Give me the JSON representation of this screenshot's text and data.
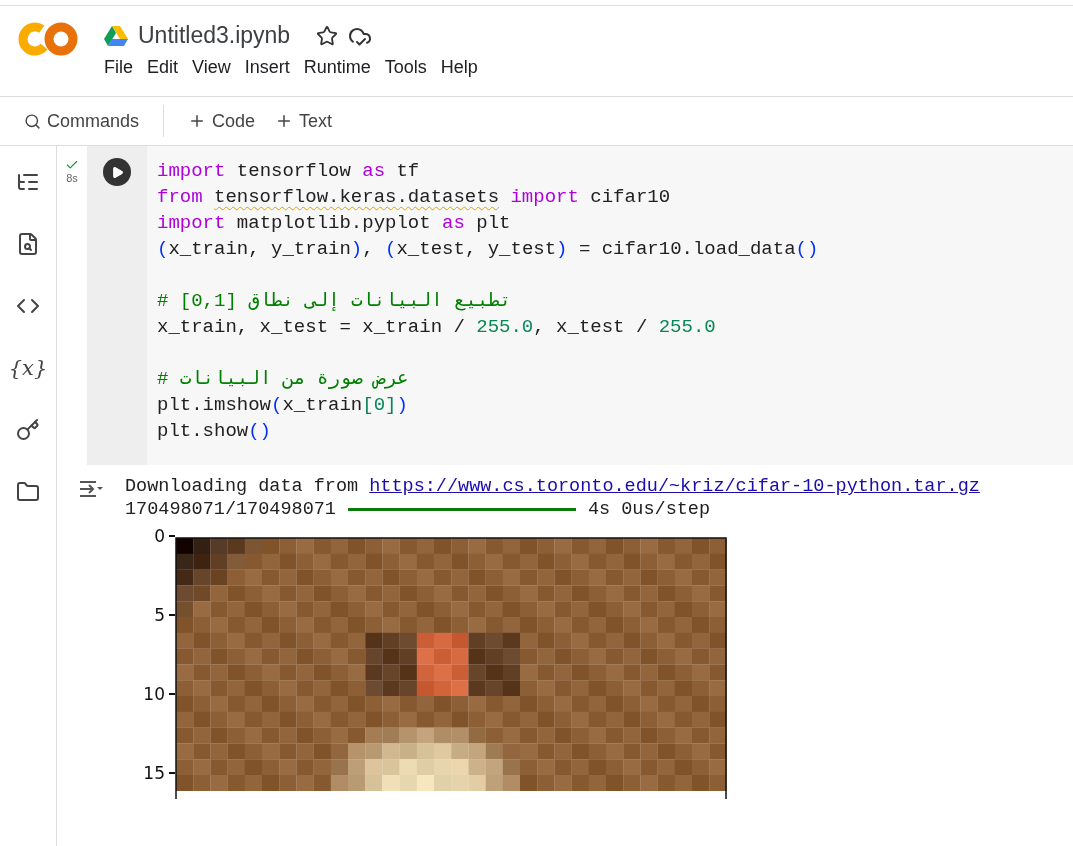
{
  "header": {
    "notebook_title": "Untitled3.ipynb",
    "menu": [
      "File",
      "Edit",
      "View",
      "Insert",
      "Runtime",
      "Tools",
      "Help"
    ]
  },
  "toolbar": {
    "search_label": "Commands",
    "buttons": [
      "Code",
      "Text"
    ]
  },
  "sidebar": {
    "variables_label": "{x}"
  },
  "cell": {
    "done": true,
    "duration": "8s",
    "code_lines": [
      [
        {
          "kind": "keyword",
          "text": "import"
        },
        {
          "kind": "plain",
          "text": " tensorflow "
        },
        {
          "kind": "keyword",
          "text": "as"
        },
        {
          "kind": "plain",
          "text": " tf"
        }
      ],
      [
        {
          "kind": "keyword",
          "text": "from "
        },
        {
          "kind": "warning",
          "text": "tensorflow.keras.datasets"
        },
        {
          "kind": "keyword",
          "text": " import"
        },
        {
          "kind": "plain",
          "text": " cifar10"
        }
      ],
      [
        {
          "kind": "keyword",
          "text": "import"
        },
        {
          "kind": "plain",
          "text": " matplotlib.pyplot "
        },
        {
          "kind": "keyword",
          "text": "as"
        },
        {
          "kind": "plain",
          "text": " plt"
        }
      ],
      [
        {
          "kind": "paren",
          "text": "("
        },
        {
          "kind": "plain",
          "text": "x_train, y_train"
        },
        {
          "kind": "paren",
          "text": ")"
        },
        {
          "kind": "plain",
          "text": ", "
        },
        {
          "kind": "paren",
          "text": "("
        },
        {
          "kind": "plain",
          "text": "x_test, y_test"
        },
        {
          "kind": "paren",
          "text": ")"
        },
        {
          "kind": "plain",
          "text": " = cifar10.load_data"
        },
        {
          "kind": "paren",
          "text": "()"
        }
      ],
      [
        {
          "kind": "blank"
        }
      ],
      [
        {
          "kind": "comment",
          "text": "# تطبيع البيانات إلى نطاق [0,1]"
        }
      ],
      [
        {
          "kind": "plain",
          "text": "x_train, x_test = x_train / "
        },
        {
          "kind": "number",
          "text": "255.0"
        },
        {
          "kind": "plain",
          "text": ", x_test / "
        },
        {
          "kind": "number",
          "text": "255.0"
        }
      ],
      [
        {
          "kind": "blank"
        }
      ],
      [
        {
          "kind": "comment",
          "text": "# عرض صورة من البيانات"
        }
      ],
      [
        {
          "kind": "plain",
          "text": "plt.imshow"
        },
        {
          "kind": "paren",
          "text": "("
        },
        {
          "kind": "plain",
          "text": "x_train"
        },
        {
          "kind": "number",
          "text": "[0]"
        },
        {
          "kind": "paren",
          "text": ")"
        }
      ],
      [
        {
          "kind": "plain",
          "text": "plt.show"
        },
        {
          "kind": "paren",
          "text": "()"
        }
      ]
    ]
  },
  "output": {
    "download_text": "Downloading data from ",
    "download_link": "https://www.cs.toronto.edu/~kriz/cifar-10-python.tar.gz",
    "progress_count": "170498071/170498071",
    "progress": {
      "level": 1
    },
    "progress_stats": "4s 0us/step",
    "image_yticks": [
      "0",
      "5",
      "10",
      "15"
    ]
  }
}
